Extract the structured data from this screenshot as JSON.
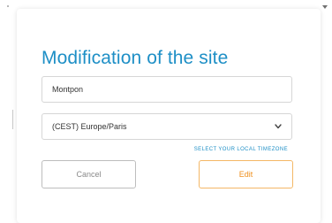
{
  "modal": {
    "title": "Modification of the site",
    "site_name_value": "Montpon",
    "timezone_selected": "(CEST) Europe/Paris",
    "timezone_hint": "SELECT YOUR LOCAL TIMEZONE",
    "cancel_label": "Cancel",
    "edit_label": "Edit"
  },
  "colors": {
    "accent_blue": "#1e8fc6",
    "edit_orange": "#ef8f1c"
  },
  "icons": {
    "select_arrow": "chevron-down-icon"
  }
}
